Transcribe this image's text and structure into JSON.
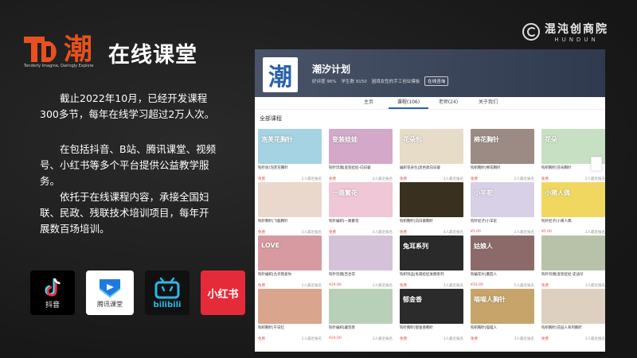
{
  "brand": {
    "title": "在线课堂",
    "logo_chars": "潮",
    "slogan": "Tenderly Imagine, Daringly Explore"
  },
  "corner_logo": {
    "cn": "混沌创商院",
    "en": "HUNDUN"
  },
  "paragraphs": [
    "截止2022年10月，已经开发课程300多节，每年在线学习超过2万人次。",
    "在包括抖音、B站、腾讯课堂、视频号、小红书等多个平台提供公益教学服务。",
    "依托于在线课程内容，承接全国妇联、民政、残联技术培训项目，每年开展数百场培训。"
  ],
  "platforms": [
    {
      "name": "抖音",
      "icon": "douyin-icon"
    },
    {
      "name": "腾讯课堂",
      "icon": "tencent-classroom-icon"
    },
    {
      "name": "bilibili",
      "icon": "bilibili-icon"
    },
    {
      "name": "小红书",
      "icon": "xiaohongshu-icon"
    }
  ],
  "screenshot": {
    "logo_char": "潮",
    "org_name": "潮汐计划",
    "meta": {
      "rating": "好评度 96%",
      "students": "学生数 9150",
      "desc": "困境女性的手工创业摸板",
      "follow": "在线咨询"
    },
    "tabs": [
      "主页",
      "课程(106)",
      "老师(24)",
      "关于我们"
    ],
    "active_tab": 1,
    "section_title": "全部课程",
    "courses": [
      {
        "thumb": "泡芙花胸针",
        "title": "钩针玫(泡芙花胸针",
        "price": "免费",
        "count": "2人最近报名",
        "color": "#a5d3e4"
      },
      {
        "thumb": "变装娃娃",
        "title": "钩针玩偶|变装娃娃-向日葵",
        "price": "免费",
        "count": "4人最近报名",
        "color": "#d4a8c9"
      },
      {
        "thumb": "花朵包",
        "title": "编织花朵包|黑色款向日葵",
        "price": "免费",
        "count": "3人最近报名",
        "color": "#e6dcc8"
      },
      {
        "thumb": "棉花胸针",
        "title": "钩织胸针|棉花胸针",
        "price": "免费",
        "count": "2人最近报名",
        "color": "#9c8b85"
      },
      {
        "thumb": "花朵",
        "title": "钩织胸针|花朵胸针",
        "price": "免费",
        "count": "2人最近报名",
        "color": "#c7e0c4"
      },
      {
        "thumb": "",
        "title": "钩针胸针|飞鹿胸针",
        "price": "免费",
        "count": "3人最近报名",
        "color": "#ead8cc"
      },
      {
        "thumb": "一路繁花",
        "title": "钩针编织|一路繁花",
        "price": "免费",
        "count": "4人最近报名",
        "color": "#f0c7d6"
      },
      {
        "thumb": "",
        "title": "钩织胸针|向日葵胸针",
        "price": "免费",
        "count": "4人最近报名",
        "color": "#3a3020"
      },
      {
        "thumb": "小羊驼",
        "title": "钩针娃子|小羊驼",
        "price": "¥5.00",
        "count": "3人最近报名",
        "color": "#d8d0e6"
      },
      {
        "thumb": "小猪人偶",
        "title": "钩针娃子|小黄人偶",
        "price": "¥5.00",
        "count": "3人最近报名",
        "color": "#f0d860"
      },
      {
        "thumb": "LOVE",
        "title": "钩针编织|允许我爱你",
        "price": "免费",
        "count": "2人最近报名",
        "color": "#d79aa0"
      },
      {
        "thumb": "",
        "title": "钩针玩偶|百合花",
        "price": "¥29.90",
        "count": "1人最近报名",
        "color": "#d4c2d8"
      },
      {
        "thumb": "兔耳系列",
        "title": "钩织饰品|兔耳娃娃发圈系列",
        "price": "免费",
        "count": "3人最近报名",
        "color": "#2a2a2a"
      },
      {
        "thumb": "姑娘人",
        "title": "钩编花片|蘑菇人",
        "price": "¥10.00",
        "count": "5人最近报名",
        "color": "#8d6a6a"
      },
      {
        "thumb": "",
        "title": "钩针玩偶|变装娃娃-史迪仔",
        "price": "免费",
        "count": "3人最近报名",
        "color": "#b8c2a8"
      },
      {
        "thumb": "",
        "title": "钩织胸针|干日红",
        "price": "免费",
        "count": "3人最近报名",
        "color": "#d9a58c"
      },
      {
        "thumb": "",
        "title": "钩针编织|藏羽草",
        "price": "¥20.00",
        "count": "3人最近报名",
        "color": "#b8d0b8"
      },
      {
        "thumb": "郁金香",
        "title": "钩针胸针|郁金香胸针",
        "price": "免费",
        "count": "3人最近报名",
        "color": "#2b2b2b"
      },
      {
        "thumb": "喵喵人胸针",
        "title": "钩织胸针|喵喵人",
        "price": "免费",
        "count": "3人最近报名",
        "color": "#c7a46a"
      },
      {
        "thumb": "",
        "title": "钩织胸针|花园人系列胸针",
        "price": "免费",
        "count": "3人最近报名",
        "color": "#ddd0c0"
      }
    ]
  }
}
